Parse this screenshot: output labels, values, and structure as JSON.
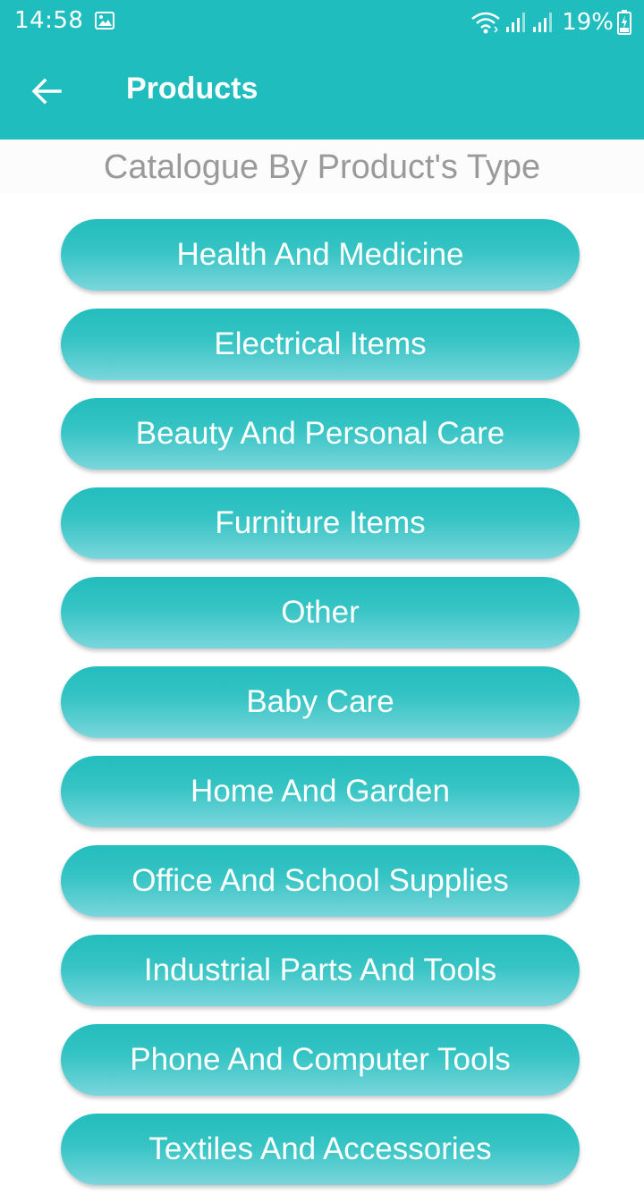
{
  "status_bar": {
    "time": "14:58",
    "battery": "19%",
    "icons": [
      "gallery-icon",
      "wifi-icon",
      "signal-icon",
      "signal-icon",
      "battery-charging-icon"
    ]
  },
  "app_bar": {
    "back_icon": "arrow-left-icon",
    "title": "Products"
  },
  "subheader": "Catalogue By Product's Type",
  "categories": [
    "Health And Medicine",
    "Electrical Items",
    "Beauty And Personal Care",
    "Furniture Items",
    "Other",
    "Baby Care",
    "Home And Garden",
    "Office And School Supplies",
    "Industrial Parts And Tools",
    "Phone And Computer Tools",
    "Textiles And Accessories"
  ],
  "colors": {
    "primary": "#1fbdbd",
    "button_gradient_top": "#22bdbd",
    "button_gradient_bottom": "#7ad6dc",
    "subheader_text": "#9a9a9a"
  }
}
